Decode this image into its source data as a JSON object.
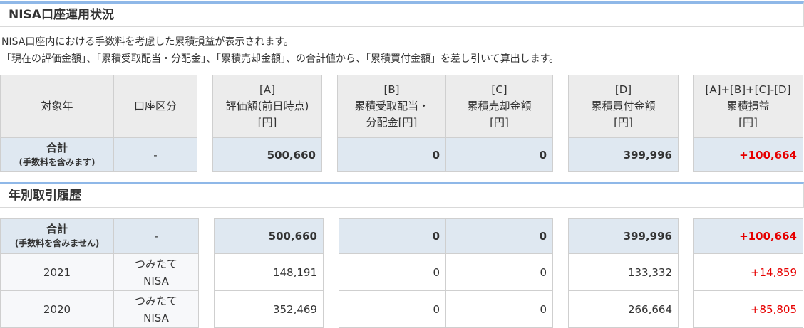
{
  "section1": {
    "title": "NISA口座運用状況",
    "desc1": "NISA口座内における手数料を考慮した累積損益が表示されます。",
    "desc2": "「現在の評価金額」、「累積受取配当・分配金」、「累積売却金額」、の合計値から、「累積買付金額」を差し引いて算出します。"
  },
  "columns": {
    "year": "対象年",
    "account": "口座区分",
    "a_l1": "[A]",
    "a_l2": "評価額(前日時点)",
    "a_l3": "[円]",
    "b_l1": "[B]",
    "b_l2": "累積受取配当・",
    "b_l3": "分配金[円]",
    "c_l1": "[C]",
    "c_l2": "累積売却金額",
    "c_l3": "[円]",
    "d_l1": "[D]",
    "d_l2": "累積買付金額",
    "d_l3": "[円]",
    "e_l1": "[A]+[B]+[C]-[D]",
    "e_l2": "累積損益",
    "e_l3": "[円]"
  },
  "summary1": {
    "label": "合計",
    "sublabel": "(手数料を含みます)",
    "account": "-",
    "a": "500,660",
    "b": "0",
    "c": "0",
    "d": "399,996",
    "e": "+100,664"
  },
  "section2": {
    "title": "年別取引履歴"
  },
  "summary2": {
    "label": "合計",
    "sublabel": "(手数料を含みません)",
    "account": "-",
    "a": "500,660",
    "b": "0",
    "c": "0",
    "d": "399,996",
    "e": "+100,664"
  },
  "rows": [
    {
      "year": "2021",
      "account_l1": "つみたて",
      "account_l2": "NISA",
      "a": "148,191",
      "b": "0",
      "c": "0",
      "d": "133,332",
      "e": "+14,859"
    },
    {
      "year": "2020",
      "account_l1": "つみたて",
      "account_l2": "NISA",
      "a": "352,469",
      "b": "0",
      "c": "0",
      "d": "266,664",
      "e": "+85,805"
    }
  ],
  "colors": {
    "header_accent": "#8fb8e8",
    "summary_bg": "#dfe8f1",
    "head_bg": "#ececec",
    "positive": "#e60000"
  }
}
